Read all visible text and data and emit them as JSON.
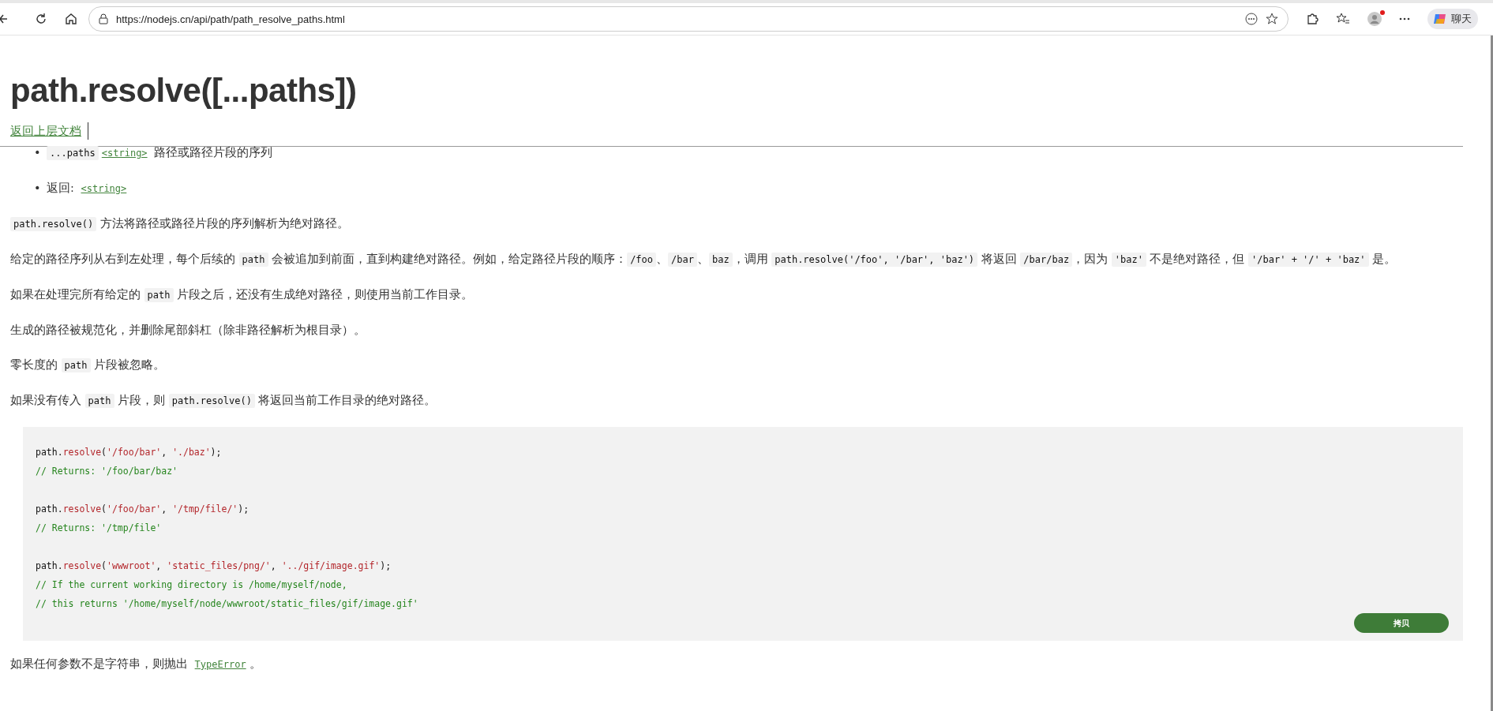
{
  "browser": {
    "url": "https://nodejs.cn/api/path/path_resolve_paths.html",
    "chat_label": "聊天",
    "profile_notification": true
  },
  "page": {
    "title": "path.resolve([...paths])",
    "back_link": "返回上层文档",
    "params": [
      {
        "bullet": "•",
        "segments": [
          {
            "kind": "code",
            "text": "...paths"
          },
          {
            "kind": "link",
            "text": "<string>"
          },
          {
            "kind": "text",
            "text": " 路径或路径片段的序列"
          }
        ]
      },
      {
        "bullet": "•",
        "segments": [
          {
            "kind": "text",
            "text": "返回: "
          },
          {
            "kind": "link",
            "text": "<string>"
          }
        ]
      }
    ],
    "paragraphs": [
      {
        "segments": [
          {
            "kind": "code",
            "text": "path.resolve()"
          },
          {
            "kind": "text",
            "text": " 方法将路径或路径片段的序列解析为绝对路径。"
          }
        ]
      },
      {
        "segments": [
          {
            "kind": "text",
            "text": "给定的路径序列从右到左处理，每个后续的 "
          },
          {
            "kind": "code",
            "text": "path"
          },
          {
            "kind": "text",
            "text": " 会被追加到前面，直到构建绝对路径。例如，给定路径片段的顺序："
          },
          {
            "kind": "code",
            "text": "/foo"
          },
          {
            "kind": "text",
            "text": "、"
          },
          {
            "kind": "code",
            "text": "/bar"
          },
          {
            "kind": "text",
            "text": "、"
          },
          {
            "kind": "code",
            "text": "baz"
          },
          {
            "kind": "text",
            "text": "，调用 "
          },
          {
            "kind": "code",
            "text": "path.resolve('/foo', '/bar', 'baz')"
          },
          {
            "kind": "text",
            "text": " 将返回 "
          },
          {
            "kind": "code",
            "text": "/bar/baz"
          },
          {
            "kind": "text",
            "text": "，因为 "
          },
          {
            "kind": "code",
            "text": "'baz'"
          },
          {
            "kind": "text",
            "text": " 不是绝对路径，但 "
          },
          {
            "kind": "code",
            "text": "'/bar' + '/' + 'baz'"
          },
          {
            "kind": "text",
            "text": " 是。"
          }
        ]
      },
      {
        "segments": [
          {
            "kind": "text",
            "text": "如果在处理完所有给定的 "
          },
          {
            "kind": "code",
            "text": "path"
          },
          {
            "kind": "text",
            "text": " 片段之后，还没有生成绝对路径，则使用当前工作目录。"
          }
        ]
      },
      {
        "segments": [
          {
            "kind": "text",
            "text": "生成的路径被规范化，并删除尾部斜杠（除非路径解析为根目录）。"
          }
        ]
      },
      {
        "segments": [
          {
            "kind": "text",
            "text": "零长度的 "
          },
          {
            "kind": "code",
            "text": "path"
          },
          {
            "kind": "text",
            "text": " 片段被忽略。"
          }
        ]
      },
      {
        "segments": [
          {
            "kind": "text",
            "text": "如果没有传入 "
          },
          {
            "kind": "code",
            "text": "path"
          },
          {
            "kind": "text",
            "text": " 片段，则 "
          },
          {
            "kind": "code",
            "text": "path.resolve()"
          },
          {
            "kind": "text",
            "text": " 将返回当前工作目录的绝对路径。"
          }
        ]
      }
    ],
    "code_block": {
      "copy_button": "拷贝",
      "groups": [
        [
          [
            {
              "kind": "plain",
              "text": "path."
            },
            {
              "kind": "method",
              "text": "resolve"
            },
            {
              "kind": "plain",
              "text": "("
            },
            {
              "kind": "string",
              "text": "'/foo/bar'"
            },
            {
              "kind": "plain",
              "text": ", "
            },
            {
              "kind": "string",
              "text": "'./baz'"
            },
            {
              "kind": "plain",
              "text": ");"
            }
          ],
          [
            {
              "kind": "comment",
              "text": "// Returns: '/foo/bar/baz'"
            }
          ]
        ],
        [
          [
            {
              "kind": "plain",
              "text": "path."
            },
            {
              "kind": "method",
              "text": "resolve"
            },
            {
              "kind": "plain",
              "text": "("
            },
            {
              "kind": "string",
              "text": "'/foo/bar'"
            },
            {
              "kind": "plain",
              "text": ", "
            },
            {
              "kind": "string",
              "text": "'/tmp/file/'"
            },
            {
              "kind": "plain",
              "text": ");"
            }
          ],
          [
            {
              "kind": "comment",
              "text": "// Returns: '/tmp/file'"
            }
          ]
        ],
        [
          [
            {
              "kind": "plain",
              "text": "path."
            },
            {
              "kind": "method",
              "text": "resolve"
            },
            {
              "kind": "plain",
              "text": "("
            },
            {
              "kind": "string",
              "text": "'wwwroot'"
            },
            {
              "kind": "plain",
              "text": ", "
            },
            {
              "kind": "string",
              "text": "'static_files/png/'"
            },
            {
              "kind": "plain",
              "text": ", "
            },
            {
              "kind": "string",
              "text": "'../gif/image.gif'"
            },
            {
              "kind": "plain",
              "text": ");"
            }
          ],
          [
            {
              "kind": "comment",
              "text": "// If the current working directory is /home/myself/node,"
            }
          ],
          [
            {
              "kind": "comment",
              "text": "// this returns '/home/myself/node/wwwroot/static_files/gif/image.gif'"
            }
          ]
        ]
      ]
    },
    "footer_paragraph": {
      "segments": [
        {
          "kind": "text",
          "text": "如果任何参数不是字符串，则抛出 "
        },
        {
          "kind": "link",
          "text": "TypeError"
        },
        {
          "kind": "text",
          "text": "。"
        }
      ]
    }
  }
}
